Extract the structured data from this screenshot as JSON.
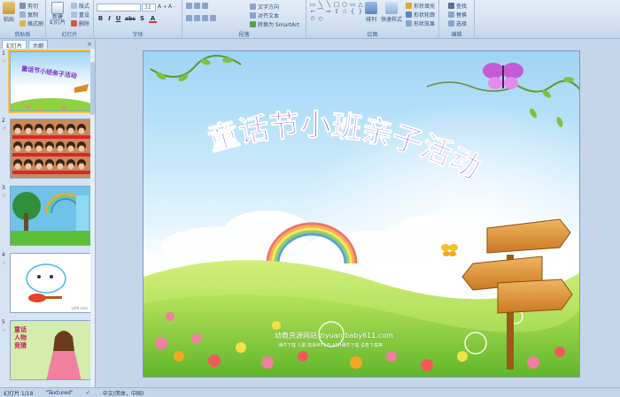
{
  "ribbon": {
    "clipboard": {
      "paste": "粘贴",
      "cut": "剪切",
      "copy": "复制",
      "format_painter": "格式刷",
      "label": "剪贴板"
    },
    "slides": {
      "new_slide": "新建\n幻灯片",
      "layout": "版式",
      "reset": "重设",
      "delete": "删除",
      "label": "幻灯片"
    },
    "font": {
      "font_name": "",
      "font_size": "32",
      "bold": "B",
      "italic": "I",
      "underline": "U",
      "strike": "abc",
      "shadow": "S",
      "label": "字体"
    },
    "paragraph": {
      "text_direction": "文字方向",
      "align_text": "对齐文本",
      "smartart": "转换为 SmartArt",
      "label": "段落"
    },
    "drawing": {
      "arrange": "排列",
      "quick_styles": "快速样式",
      "shape_fill": "形状填充",
      "shape_outline": "形状轮廓",
      "shape_effects": "形状效果",
      "label": "绘图"
    },
    "editing": {
      "find": "查找",
      "replace": "替换",
      "select": "选择",
      "label": "编辑"
    }
  },
  "left_panel": {
    "tab_slides": "幻灯片",
    "tab_outline": "大纲",
    "close": "×",
    "thumbnails": [
      {
        "num": "1",
        "star": "☆",
        "title": "童话节小班亲子活动"
      },
      {
        "num": "2",
        "star": "☆"
      },
      {
        "num": "3",
        "star": "☆"
      },
      {
        "num": "4",
        "star": "☆",
        "caption": "ykt6.com"
      },
      {
        "num": "5",
        "star": "☆",
        "caption": "童话人物竞猜"
      }
    ]
  },
  "slide": {
    "title": "童话节小班亲子活动",
    "watermark_line1": "幼教资源网站 ziyuan.baby611.com",
    "watermark_line2": "课件下载   儿歌   故事MP3   FLASH课件下载   试卷下载等"
  },
  "status": {
    "slide_count": "幻灯片 1/18",
    "theme": "\"Textured\"",
    "language": "中文(简体，中国)"
  },
  "colors": {
    "title": "#7a2fc2",
    "sky": "#9fd4f5",
    "grass": "#8fd13f",
    "sign": "#d98a2b"
  }
}
